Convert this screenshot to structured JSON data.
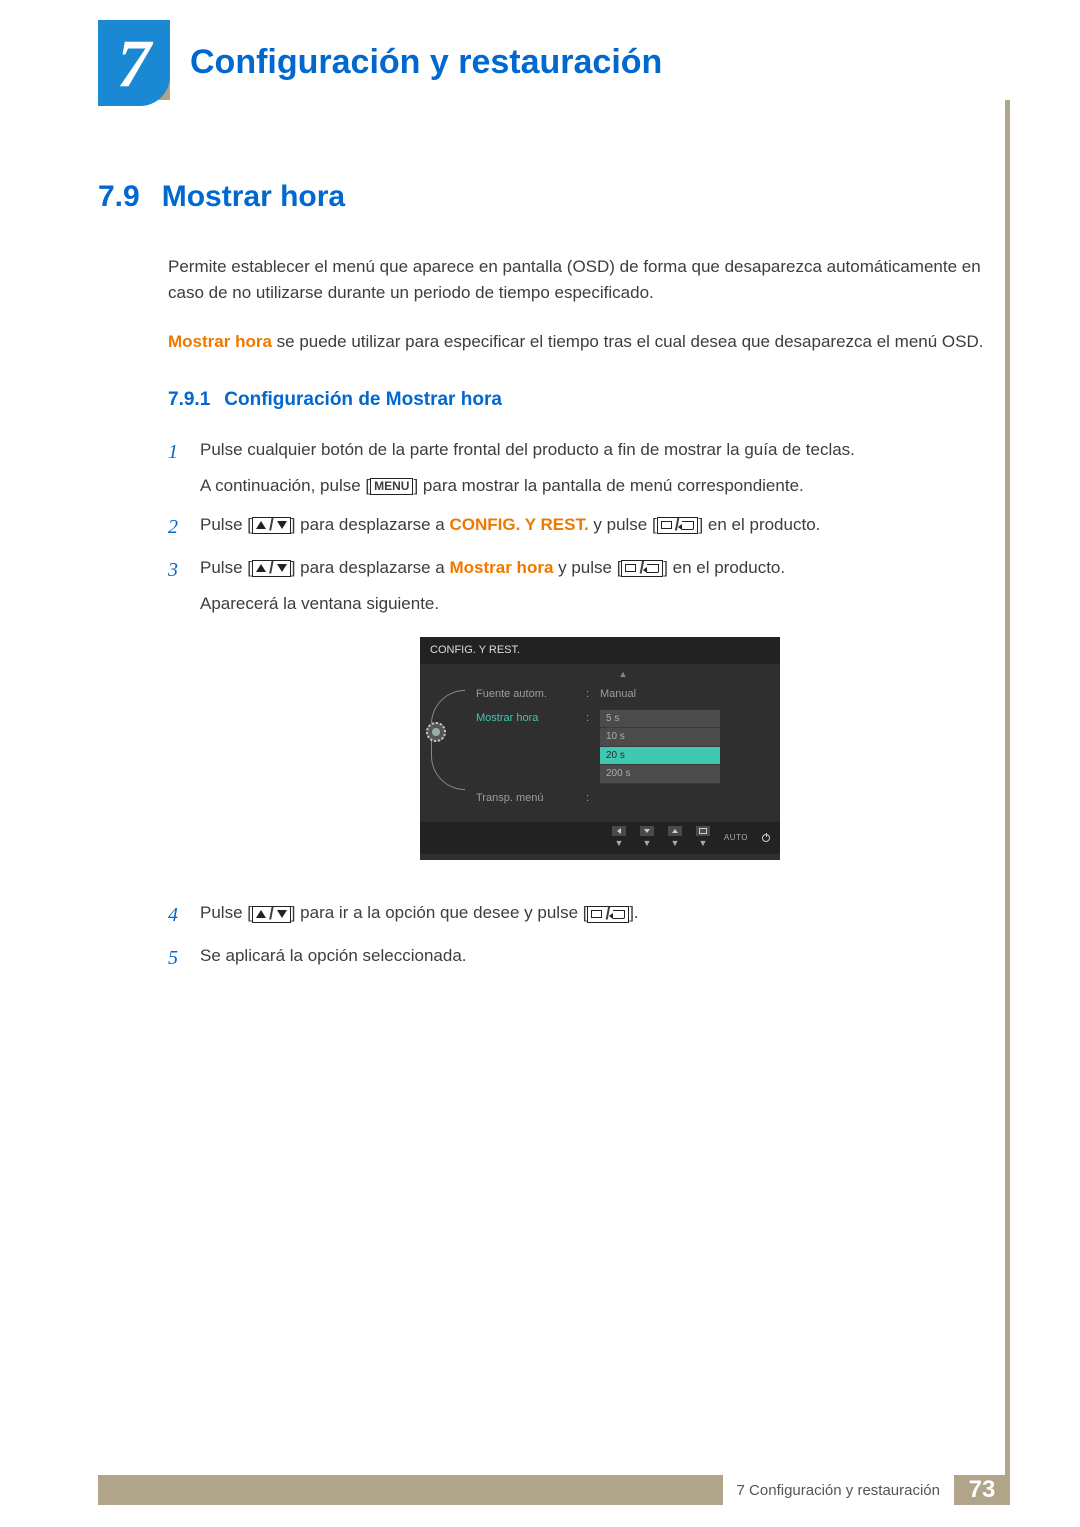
{
  "chapter": {
    "number": "7",
    "title": "Configuración y restauración"
  },
  "section": {
    "number": "7.9",
    "title": "Mostrar hora"
  },
  "intro": {
    "p1": "Permite establecer el menú que aparece en pantalla (OSD) de forma que desaparezca automáticamente en caso de no utilizarse durante un periodo de tiempo especificado.",
    "p2_highlight": "Mostrar hora",
    "p2_rest": " se puede utilizar para especificar el tiempo tras el cual desea que desaparezca el menú OSD."
  },
  "subsection": {
    "number": "7.9.1",
    "title": "Configuración de Mostrar hora"
  },
  "steps": {
    "s1a": "Pulse cualquier botón de la parte frontal del producto a fin de mostrar la guía de teclas.",
    "s1b_pre": "A continuación, pulse [",
    "s1b_menu": "MENU",
    "s1b_post": "] para mostrar la pantalla de menú correspondiente.",
    "s2_pre": "Pulse [",
    "s2_mid1": "] para desplazarse a ",
    "s2_highlight": "CONFIG. Y REST.",
    "s2_mid2": " y pulse [",
    "s2_post": "] en el producto.",
    "s3_pre": "Pulse [",
    "s3_mid1": "] para desplazarse a ",
    "s3_highlight": "Mostrar hora",
    "s3_mid2": " y pulse [",
    "s3_post": "] en el producto.",
    "s3_b": "Aparecerá la ventana siguiente.",
    "s4_pre": "Pulse [",
    "s4_mid": "] para ir a la opción que desee y pulse [",
    "s4_post": "].",
    "s5": "Se aplicará la opción seleccionada."
  },
  "osd": {
    "header": "CONFIG. Y REST.",
    "rows": [
      {
        "label": "Fuente autom.",
        "value": "Manual"
      },
      {
        "label": "Mostrar hora",
        "active": true
      },
      {
        "label": "Transp. menú"
      }
    ],
    "options": [
      "5 s",
      "10 s",
      "20 s",
      "200 s"
    ],
    "selected_option": "20 s",
    "auto": "AUTO"
  },
  "footer": {
    "text": "7 Configuración y restauración",
    "page": "73"
  }
}
